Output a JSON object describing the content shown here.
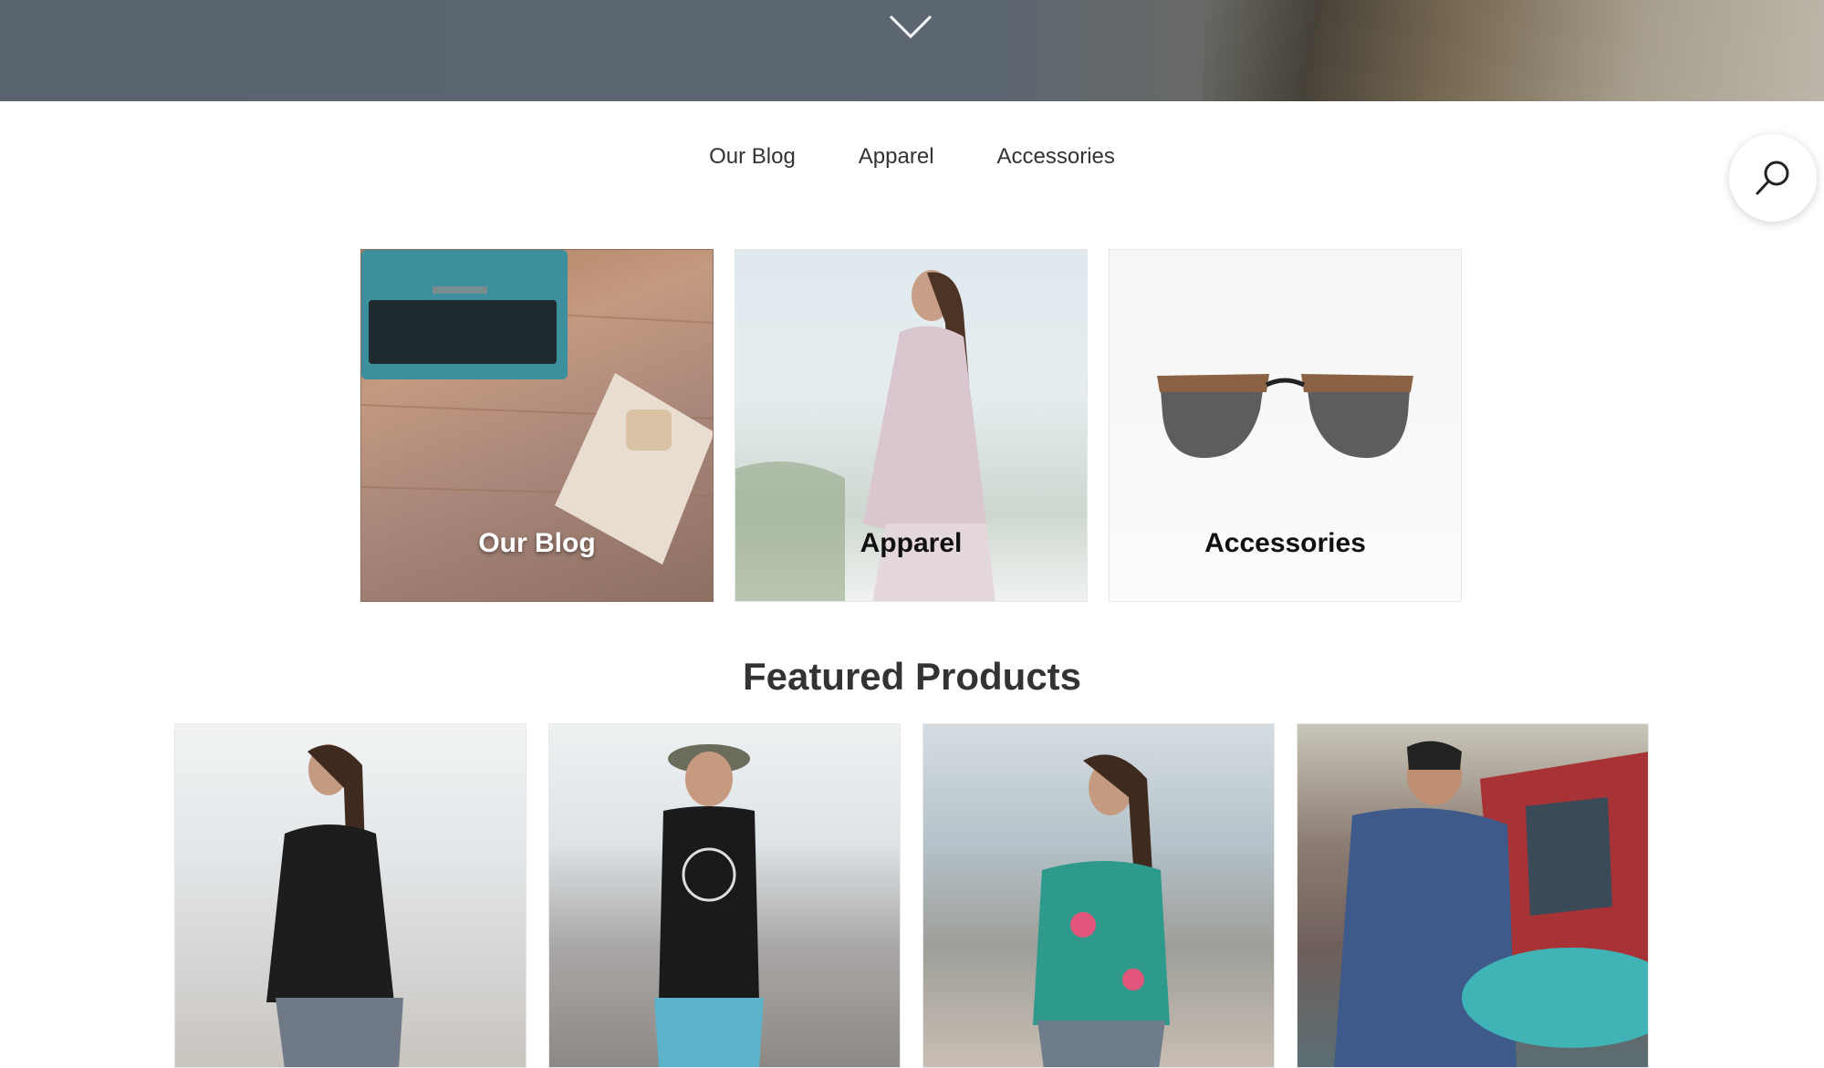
{
  "hero": {
    "scroll_icon": "chevron-down-icon"
  },
  "nav": {
    "items": [
      {
        "label": "Our Blog"
      },
      {
        "label": "Apparel"
      },
      {
        "label": "Accessories"
      }
    ]
  },
  "search": {
    "icon": "search-icon"
  },
  "categories": [
    {
      "label": "Our Blog"
    },
    {
      "label": "Apparel"
    },
    {
      "label": "Accessories"
    }
  ],
  "featured": {
    "title": "Featured Products"
  }
}
